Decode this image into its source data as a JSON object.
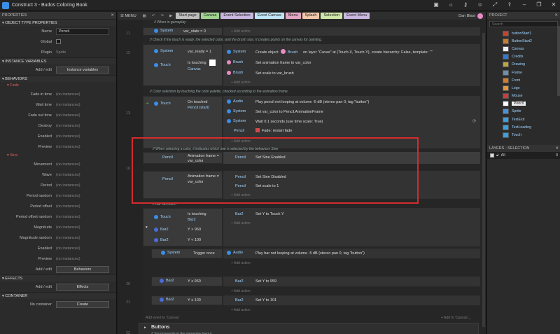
{
  "window": {
    "title": "Construct 3 - Budos Coloring Book"
  },
  "titlebar_icons": [
    "save-icon",
    "sun-icon",
    "key-icon",
    "users-icon",
    "expand-icon",
    "share-icon",
    "minimize-icon",
    "restore-icon",
    "close-icon"
  ],
  "left_panel": {
    "title": "PROPERTIES",
    "sections": {
      "object_type": "OBJECT TYPE PROPERTIES",
      "instance_vars": "INSTANCE VARIABLES",
      "behaviors": "BEHAVIORS",
      "effects": "EFFECTS",
      "container": "CONTAINER"
    },
    "name_label": "Name",
    "name_value": "Pencil",
    "global_label": "Global",
    "plugin_label": "Plugin",
    "plugin_value": "Sprite",
    "addedit_label": "Add / edit",
    "instance_vars_btn": "Instance variables",
    "fade_title": "Fade",
    "fade_rows": [
      "Fade in time",
      "Wait time",
      "Fade out time",
      "Destroy",
      "Enabled",
      "Preview"
    ],
    "sine_title": "Sine",
    "sine_rows": [
      "Movement",
      "Wave",
      "Period",
      "Period random",
      "Period offset",
      "Period offset random",
      "Magnitude",
      "Magnitude random",
      "Enabled",
      "Preview"
    ],
    "no_instances": "(no instances)",
    "behaviors_btn": "Behaviors",
    "effects_btn": "Effects",
    "no_container": "No container",
    "create_btn": "Create"
  },
  "tabs": {
    "menu": "MENU",
    "items": [
      "Start page",
      "Canvas",
      "Event Selection",
      "Event Canvas",
      "Menu",
      "Splash",
      "Selection",
      "Event Menu"
    ],
    "user": "Dan Blast"
  },
  "events": {
    "l1": "// When in gameplay",
    "sys": "System",
    "var_state": "var_state = 0",
    "add_action": "+ Add action",
    "l2": "// Check if the touch is ready, the selected color, and the brush size. It creates points on the canvas for painting.",
    "var_ready": "var_ready = 1",
    "touch": "Touch",
    "is_touching": "Is touching",
    "canvas": "Canvas",
    "create_obj": "Create object",
    "brush": "Brush",
    "create_tail": "on layer \"Cavas\" at (Touch.X, Touch.Y), create hierarchy: False, template: \"\"",
    "set_anim_frame": "Set animation frame to var_color",
    "set_scale_brush": "Set scale to var_brush",
    "l3": "// Color selection by touching the color palette, checked according to the animation frame.",
    "on_touched": "On touched",
    "pencil_start": "Pencil (start)",
    "audio": "Audio",
    "play_pencil": "Play pencil not looping at volume -5 dB (stereo pan 0, tag \"button\")",
    "set_var_color": "Set var_color to Pencil.AnimationFrame",
    "wait": "Wait 0.1 seconds (use time scale: True)",
    "pencil": "Pencil",
    "fade_restart": "Fade: restart fade",
    "l4": "// When selecting a color, it indicates which one is selected by the behaviors Sine",
    "anim_eq": "Animation frame =",
    "var_color": "var_color",
    "anim_ne": "Animation frame ≠",
    "set_sine_enabled": "Set  Sine Enabled",
    "set_sine_disabled": "Set  Sine Disabled",
    "set_scale_1": "Set scale to 1",
    "l5": "// Bar set touch",
    "bar2": "Bar2",
    "gt960": "Y > 960",
    "lt100": "Y < 100",
    "set_y_touch": "Set Y to Touch.Y",
    "trigger_once": "Trigger once",
    "play_bar": "Play bar not looping at volume -5 dB (stereo pan 0, tag \"button\")",
    "ge960": "Y ≥ 960",
    "set_y_959": "Set Y to 959",
    "le100": "Y ≤ 100",
    "set_y_101": "Set Y to 101",
    "add_event": "Add event to 'Canvas'",
    "add_to": "+ Add to 'Canvas'...",
    "buttons": "Buttons",
    "l6": "// Sound events in the gameplay layout"
  },
  "line_numbers": [
    "11",
    "12",
    "13",
    "16",
    "",
    "20",
    "21",
    "",
    "22"
  ],
  "project": {
    "title": "PROJECT",
    "search": "Search",
    "items": [
      "buttonStart1",
      "ButtonStart2",
      "Canvas",
      "Credits",
      "Drawing",
      "Frame",
      "Front",
      "Logo",
      "Mouse",
      "Pencil",
      "Sprite",
      "TextExit",
      "TextLoading",
      "Touch"
    ]
  },
  "layers": {
    "title": "LAYERS - SELECTION",
    "row": "All",
    "count": "0"
  },
  "colors": {
    "tab_canvas": "#9fd28f",
    "tab_evsel": "#c9b7e0",
    "tab_evcanvas": "#bfe4f5",
    "tab_menu": "#e3a5c4",
    "tab_splash": "#f1c7a9",
    "tab_selection": "#cfe7a7",
    "tab_evmenu": "#c9b7e0",
    "highlight": "#d42c2c"
  }
}
